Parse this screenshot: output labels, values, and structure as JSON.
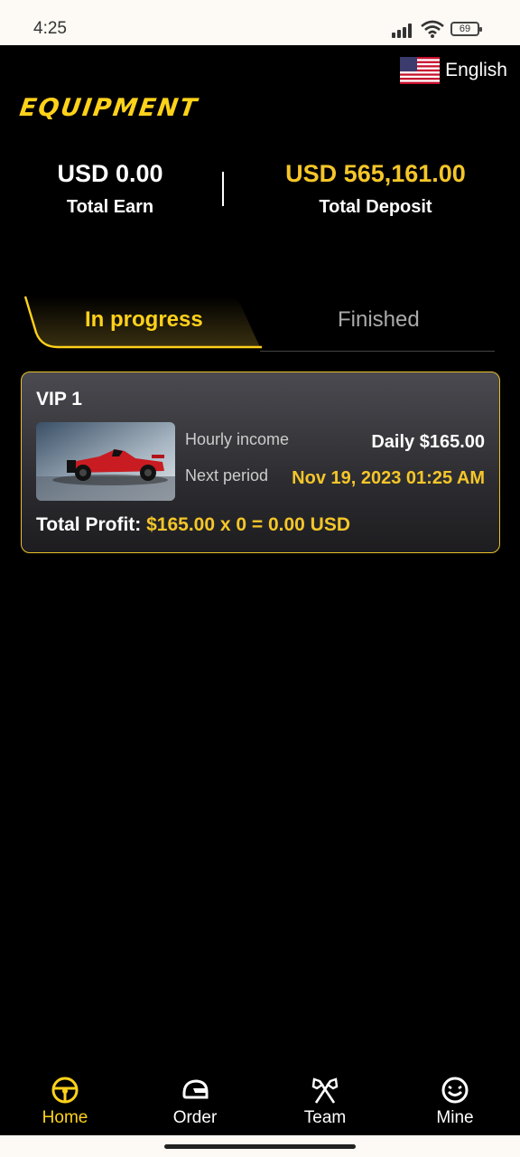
{
  "status_bar": {
    "time": "4:25",
    "battery": "69"
  },
  "header": {
    "brand": "EQUIPMENT",
    "language": "English"
  },
  "totals": {
    "earn": {
      "amount": "USD 0.00",
      "label": "Total Earn"
    },
    "deposit": {
      "amount": "USD 565,161.00",
      "label": "Total Deposit"
    }
  },
  "tabs": [
    {
      "label": "In progress"
    },
    {
      "label": "Finished"
    }
  ],
  "card": {
    "title": "VIP 1",
    "hourly_label": "Hourly income",
    "hourly_value": "Daily $165.00",
    "next_label": "Next period",
    "next_value": "Nov 19, 2023 01:25 AM",
    "profit_prefix": "Total Profit:",
    "profit_expr": "$165.00 x 0 = 0.00 USD"
  },
  "nav": [
    {
      "label": "Home",
      "icon": "steering-wheel-icon"
    },
    {
      "label": "Order",
      "icon": "helmet-icon"
    },
    {
      "label": "Team",
      "icon": "crossed-flags-icon"
    },
    {
      "label": "Mine",
      "icon": "smiley-icon"
    }
  ],
  "colors": {
    "accent": "#ffd21a",
    "gold_text": "#f5c629",
    "background": "#000000"
  }
}
